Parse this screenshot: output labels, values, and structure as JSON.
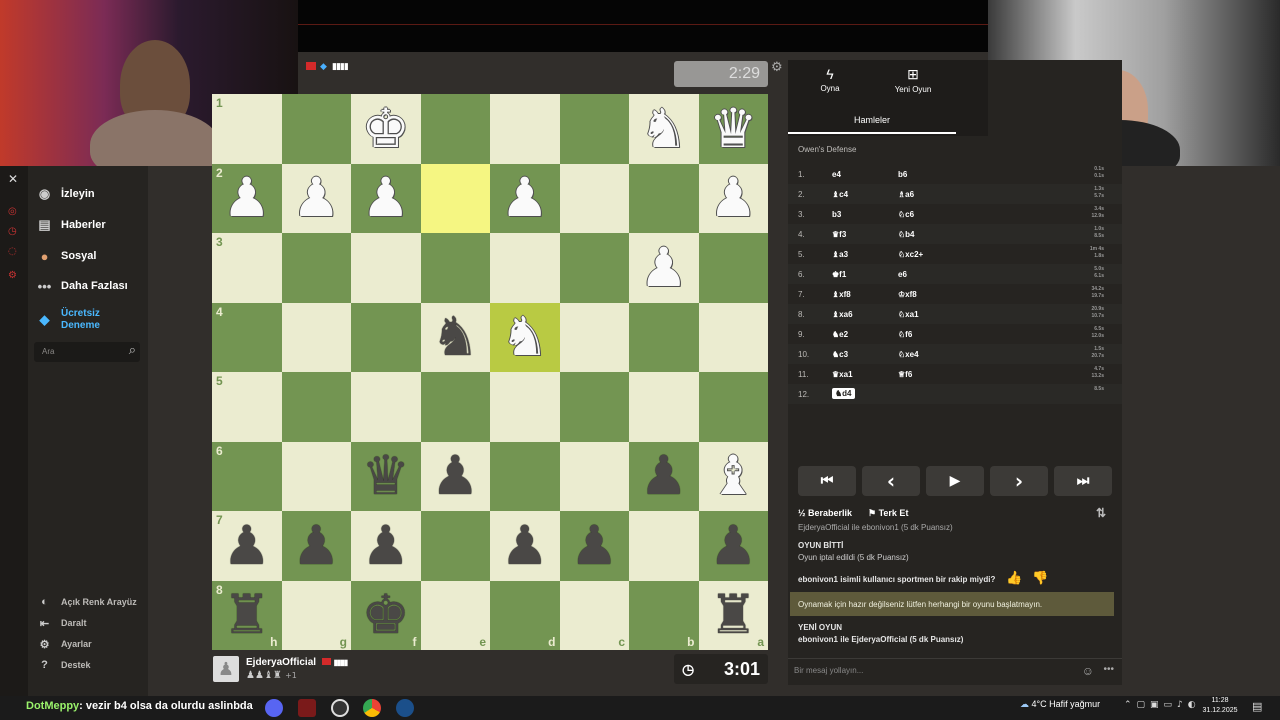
{
  "top_player": {
    "clock": "2:29"
  },
  "bottom_player": {
    "name": "EjderyaOfficial",
    "captured_extra": "+1",
    "clock": "3:01"
  },
  "sidebar": {
    "items": [
      {
        "label": "İzleyin",
        "icon": "binoculars-icon"
      },
      {
        "label": "Haberler",
        "icon": "newspaper-icon"
      },
      {
        "label": "Sosyal",
        "icon": "people-icon"
      },
      {
        "label": "Daha Fazlası",
        "icon": "more-dots-icon"
      }
    ],
    "trial_line1": "Ücretsiz",
    "trial_line2": "Deneme",
    "search_placeholder": "Ara",
    "bottom": [
      {
        "label": "Açık Renk Arayüz",
        "icon": "theme-icon"
      },
      {
        "label": "Daralt",
        "icon": "collapse-icon"
      },
      {
        "label": "Ayarlar",
        "icon": "gear-icon"
      },
      {
        "label": "Destek",
        "icon": "help-icon"
      }
    ]
  },
  "board": {
    "ranks": [
      "1",
      "2",
      "3",
      "4",
      "5",
      "6",
      "7",
      "8"
    ],
    "files": [
      "h",
      "g",
      "f",
      "e",
      "d",
      "c",
      "b",
      "a"
    ],
    "squares": [
      [
        "",
        "",
        "wK",
        "",
        "",
        "",
        "wN",
        "wQ"
      ],
      [
        "wP",
        "wP",
        "wP",
        "",
        "wP",
        "",
        "",
        "wP"
      ],
      [
        "",
        "",
        "",
        "",
        "",
        "",
        "wP",
        ""
      ],
      [
        "",
        "",
        "",
        "bN",
        "wN",
        "",
        "",
        ""
      ],
      [
        "",
        "",
        "",
        "",
        "",
        "",
        "",
        ""
      ],
      [
        "",
        "",
        "bQ",
        "bP",
        "",
        "",
        "bP",
        "wB"
      ],
      [
        "bP",
        "bP",
        "bP",
        "",
        "bP",
        "bP",
        "",
        "bP"
      ],
      [
        "bR",
        "",
        "bK",
        "",
        "",
        "",
        "",
        "bR"
      ]
    ],
    "highlights": [
      [
        1,
        3
      ],
      [
        3,
        4
      ]
    ]
  },
  "right_panel": {
    "tabs": [
      {
        "label": "Oyna",
        "icon": "bolt-icon"
      },
      {
        "label": "Yeni Oyun",
        "icon": "plus-icon"
      }
    ],
    "subtab": "Hamleler",
    "opening": "Owen's Defense",
    "moves": [
      {
        "n": "1.",
        "w": "e4",
        "b": "b6",
        "t1": "0.1s",
        "t2": "0.1s"
      },
      {
        "n": "2.",
        "w": "♝c4",
        "b": "♗a6",
        "t1": "1.3s",
        "t2": "5.7s"
      },
      {
        "n": "3.",
        "w": "b3",
        "b": "♘c6",
        "t1": "3.4s",
        "t2": "12.9s"
      },
      {
        "n": "4.",
        "w": "♛f3",
        "b": "♘b4",
        "t1": "1.0s",
        "t2": "8.5s"
      },
      {
        "n": "5.",
        "w": "♝a3",
        "b": "♘xc2+",
        "t1": "1m 4s",
        "t2": "1.8s"
      },
      {
        "n": "6.",
        "w": "♚f1",
        "b": "e6",
        "t1": "5.0s",
        "t2": "6.1s"
      },
      {
        "n": "7.",
        "w": "♝xf8",
        "b": "♔xf8",
        "t1": "34.2s",
        "t2": "19.7s"
      },
      {
        "n": "8.",
        "w": "♝xa6",
        "b": "♘xa1",
        "t1": "20.9s",
        "t2": "10.7s"
      },
      {
        "n": "9.",
        "w": "♞e2",
        "b": "♘f6",
        "t1": "6.5s",
        "t2": "12.0s"
      },
      {
        "n": "10.",
        "w": "♞c3",
        "b": "♘xe4",
        "t1": "1.5s",
        "t2": "20.7s"
      },
      {
        "n": "11.",
        "w": "♛xa1",
        "b": "♕f6",
        "t1": "4.7s",
        "t2": "13.2s"
      },
      {
        "n": "12.",
        "w": "♞d4",
        "b": "",
        "t1": "8.5s",
        "t2": ""
      }
    ],
    "controls": [
      "⏮",
      "‹",
      "▶",
      "›",
      "⏭"
    ],
    "draw_label": "Beraberlik",
    "resign_label": "Terk Et",
    "chat": {
      "line0": "EjderyaOfficial ile ebonivon1 (5 dk Puansız)",
      "game_over": "OYUN BİTTİ",
      "cancelled": "Oyun iptal edildi (5 dk Puansız)",
      "sportsman_q": "ebonivon1 isimli kullanıcı sportmen bir rakip miydi?",
      "notice": "Oynamak için hazır değilseniz lütfen herhangi bir oyunu başlatmayın.",
      "new_game": "YENİ OYUN",
      "new_game_detail": "ebonivon1 ile EjderyaOfficial (5 dk Puansız)",
      "input_placeholder": "Bir mesaj yollayın..."
    }
  },
  "stream_overlay": {
    "nick": "DotMeppy",
    "message": ": vezir b4 olsa da olurdu aslinbda"
  },
  "taskbar": {
    "weather": "4°C  Hafif yağmur",
    "time": "11:28",
    "date": "31.12.2025"
  }
}
